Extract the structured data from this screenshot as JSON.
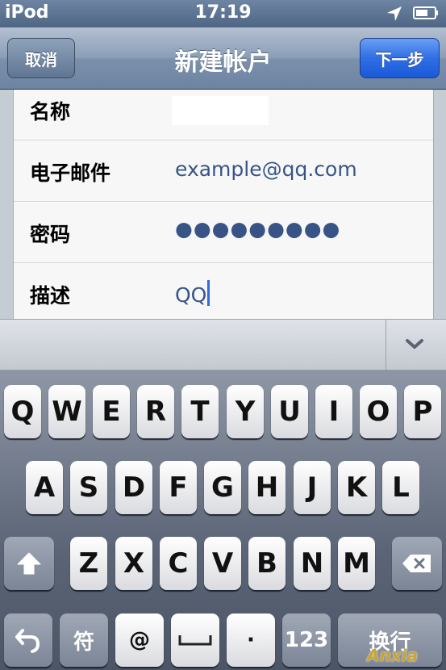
{
  "status_bar": {
    "carrier": "iPod",
    "time": "17:19",
    "icons": [
      "location-arrow-icon",
      "battery-icon"
    ]
  },
  "nav_bar": {
    "cancel_label": "取消",
    "title": "新建帐户",
    "next_label": "下一步"
  },
  "form": {
    "rows": [
      {
        "label": "名称",
        "value": ""
      },
      {
        "label": "电子邮件",
        "value": "example@qq.com"
      },
      {
        "label": "密码",
        "value": "●●●●●●●●●"
      },
      {
        "label": "描述",
        "value": "QQ"
      }
    ]
  },
  "accessory": {
    "dismiss_icon": "chevron-down-icon"
  },
  "keyboard": {
    "row1": [
      "Q",
      "W",
      "E",
      "R",
      "T",
      "Y",
      "U",
      "I",
      "O",
      "P"
    ],
    "row2": [
      "A",
      "S",
      "D",
      "F",
      "G",
      "H",
      "J",
      "K",
      "L"
    ],
    "row3": [
      "Z",
      "X",
      "C",
      "V",
      "B",
      "N",
      "M"
    ],
    "bottom": {
      "symbols": "符",
      "at": "@",
      "dot": "·",
      "numbers": "123",
      "return": "换行"
    },
    "icons": [
      "shift-icon",
      "delete-icon",
      "undo-icon",
      "space-icon"
    ]
  },
  "watermark": "Anxia"
}
